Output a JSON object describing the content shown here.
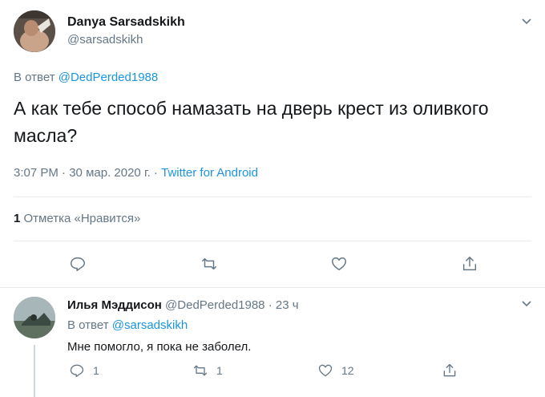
{
  "tweet": {
    "author_name": "Danya Sarsadskikh",
    "author_handle": "@sarsadskikh",
    "reply_prefix": "В ответ",
    "reply_to": "@DedPerded1988",
    "text": "А как тебе способ намазать на дверь крест из оливкого масла?",
    "time": "3:07 PM",
    "date": "30 мар. 2020 г.",
    "source": "Twitter for Android",
    "likes_count": "1",
    "likes_label": "Отметка «Нравится»",
    "icons": [
      "reply-icon",
      "retweet-icon",
      "like-icon",
      "share-icon",
      "chevron-down-icon"
    ]
  },
  "reply": {
    "author_name": "Илья Мэддисон",
    "author_handle": "@DedPerded1988",
    "time": "23 ч",
    "reply_prefix": "В ответ",
    "reply_to": "@sarsadskikh",
    "text": "Мне помогло, я пока не заболел.",
    "reply_count": "1",
    "retweet_count": "1",
    "like_count": "12"
  },
  "colors": {
    "link": "#1b95e0",
    "secondary_text": "#657786",
    "divider": "#e6ecf0"
  }
}
